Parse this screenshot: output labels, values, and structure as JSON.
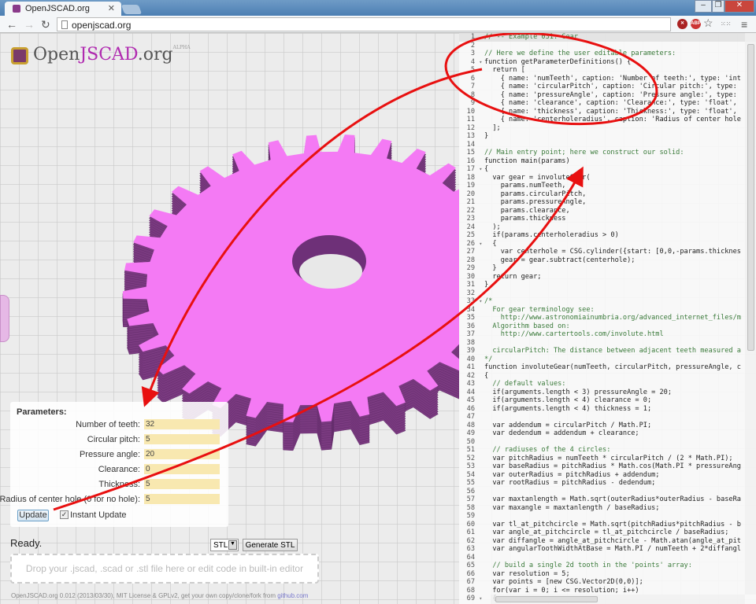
{
  "browser": {
    "tab_title": "OpenJSCAD.org",
    "url": "openjscad.org",
    "window_buttons": [
      "–",
      "❐",
      "✕"
    ]
  },
  "logo": {
    "open": "Open",
    "js": "JSCAD",
    ".org": ".org",
    "badge": "ALPHA"
  },
  "colors": {
    "gear_top": "#f47af4",
    "gear_side": "#7a3a80",
    "annotation": "#e81010",
    "param_field": "#f8e8b0"
  },
  "gear": {
    "num_teeth": 32
  },
  "params": {
    "title": "Parameters:",
    "rows": [
      {
        "label": "Number of teeth:",
        "value": "32"
      },
      {
        "label": "Circular pitch:",
        "value": "5"
      },
      {
        "label": "Pressure angle:",
        "value": "20"
      },
      {
        "label": "Clearance:",
        "value": "0"
      },
      {
        "label": "Thickness:",
        "value": "5"
      },
      {
        "label": "Radius of center hole (0 for no hole):",
        "value": "5"
      }
    ],
    "update_label": "Update",
    "instant_update_label": "Instant Update",
    "instant_update_checked": true
  },
  "status": "Ready.",
  "format": {
    "selected": "STL"
  },
  "generate_label": "Generate STL",
  "drop_text": "Drop your .jscad, .scad or .stl file here or edit code in built-in editor",
  "footer": {
    "text": "OpenJSCAD.org 0.012 (2013/03/30), MIT License & GPLv2, get your own copy/clone/fork from ",
    "link": "github.com"
  },
  "editor": {
    "start_line": 1,
    "lines": [
      "// -- Example 031: Gear",
      "",
      "// Here we define the user editable parameters:",
      "function getParameterDefinitions() {",
      "  return [",
      "    { name: 'numTeeth', caption: 'Number of teeth:', type: 'int",
      "    { name: 'circularPitch', caption: 'Circular pitch:', type:",
      "    { name: 'pressureAngle', caption: 'Pressure angle:', type:",
      "    { name: 'clearance', caption: 'Clearance:', type: 'float',",
      "    { name: 'thickness', caption: 'Thickness:', type: 'float',",
      "    { name: 'centerholeradius', caption: 'Radius of center hole",
      "  ];",
      "}",
      "",
      "// Main entry point; here we construct our solid:",
      "function main(params)",
      "{",
      "  var gear = involuteGear(",
      "    params.numTeeth,",
      "    params.circularPitch,",
      "    params.pressureAngle,",
      "    params.clearance,",
      "    params.thickness",
      "  );",
      "  if(params.centerholeradius > 0)",
      "  {",
      "    var centerhole = CSG.cylinder({start: [0,0,-params.thicknes",
      "    gear = gear.subtract(centerhole);",
      "  }",
      "  return gear;",
      "}",
      "",
      "/*",
      "  For gear terminology see:",
      "    http://www.astronomiainumbria.org/advanced_internet_files/m",
      "  Algorithm based on:",
      "    http://www.cartertools.com/involute.html",
      "",
      "  circularPitch: The distance between adjacent teeth measured a",
      "*/",
      "function involuteGear(numTeeth, circularPitch, pressureAngle, c",
      "{",
      "  // default values:",
      "  if(arguments.length < 3) pressureAngle = 20;",
      "  if(arguments.length < 4) clearance = 0;",
      "  if(arguments.length < 4) thickness = 1;",
      "",
      "  var addendum = circularPitch / Math.PI;",
      "  var dedendum = addendum + clearance;",
      "",
      "  // radiuses of the 4 circles:",
      "  var pitchRadius = numTeeth * circularPitch / (2 * Math.PI);",
      "  var baseRadius = pitchRadius * Math.cos(Math.PI * pressureAng",
      "  var outerRadius = pitchRadius + addendum;",
      "  var rootRadius = pitchRadius - dedendum;",
      "",
      "  var maxtanlength = Math.sqrt(outerRadius*outerRadius - baseRa",
      "  var maxangle = maxtanlength / baseRadius;",
      "",
      "  var tl_at_pitchcircle = Math.sqrt(pitchRadius*pitchRadius - b",
      "  var angle_at_pitchcircle = tl_at_pitchcircle / baseRadius;",
      "  var diffangle = angle_at_pitchcircle - Math.atan(angle_at_pit",
      "  var angularToothWidthAtBase = Math.PI / numTeeth + 2*diffangl",
      "",
      "  // build a single 2d tooth in the 'points' array:",
      "  var resolution = 5;",
      "  var points = [new CSG.Vector2D(0,0)];",
      "  for(var i = 0; i <= resolution; i++)",
      "  {"
    ],
    "foldable_lines": [
      4,
      5,
      17,
      26,
      33,
      69
    ]
  }
}
